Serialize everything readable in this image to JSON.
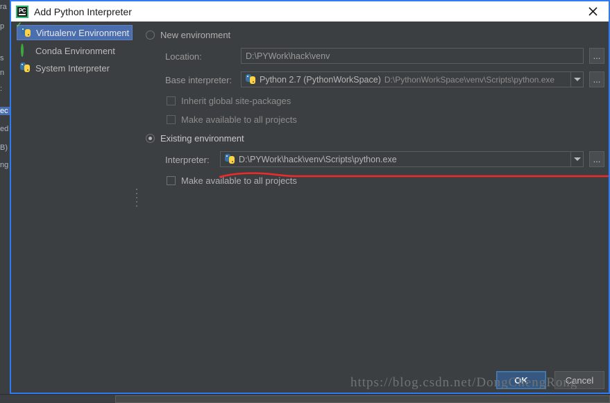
{
  "window": {
    "title": "Add Python Interpreter",
    "app_icon": "pycharm-icon",
    "close_icon": "close-icon",
    "accent_color": "#2d7cf6",
    "background_color": "#3c3f41"
  },
  "sidebar": {
    "items": [
      {
        "label": "Virtualenv Environment",
        "icon": "python-virtualenv-icon",
        "selected": true
      },
      {
        "label": "Conda Environment",
        "icon": "conda-ring-icon",
        "selected": false
      },
      {
        "label": "System Interpreter",
        "icon": "python-icon",
        "selected": false
      }
    ],
    "selected_color": "#4b6eaf"
  },
  "splitter": {
    "icon": "splitter-grip-icon"
  },
  "new_environment": {
    "radio_label": "New environment",
    "selected": false,
    "location": {
      "label": "Location:",
      "value": "D:\\PYWork\\hack\\venv",
      "browse_label": "...",
      "enabled": false
    },
    "base_interpreter": {
      "label": "Base interpreter:",
      "value": "Python 2.7 (PythonWorkSpace)",
      "path": "D:\\PythonWorkSpace\\venv\\Scripts\\python.exe",
      "icon": "python-icon",
      "dropdown_icon": "chevron-down-icon",
      "browse_label": "...",
      "enabled": false
    },
    "checkboxes": [
      {
        "label": "Inherit global site-packages",
        "checked": false,
        "enabled": false
      },
      {
        "label": "Make available to all projects",
        "checked": false,
        "enabled": false
      }
    ]
  },
  "existing_environment": {
    "radio_label": "Existing environment",
    "selected": true,
    "interpreter": {
      "label": "Interpreter:",
      "value": "D:\\PYWork\\hack\\venv\\Scripts\\python.exe",
      "icon": "python-icon",
      "dropdown_icon": "chevron-down-icon",
      "browse_label": "...",
      "enabled": true
    },
    "checkboxes": [
      {
        "label": "Make available to all projects",
        "checked": false,
        "enabled": true
      }
    ]
  },
  "annotation": {
    "type": "red-underline",
    "color": "#ef2a2a"
  },
  "footer": {
    "ok_label": "OK",
    "cancel_label": "Cancel",
    "ok_color": "#365880"
  },
  "watermark": {
    "text": "https://blog.csdn.net/DongChengRong"
  },
  "background_window": {
    "fragments": [
      "ra",
      "p",
      "s",
      "n",
      ":",
      "ec",
      "ed",
      "B)",
      "ng"
    ]
  }
}
